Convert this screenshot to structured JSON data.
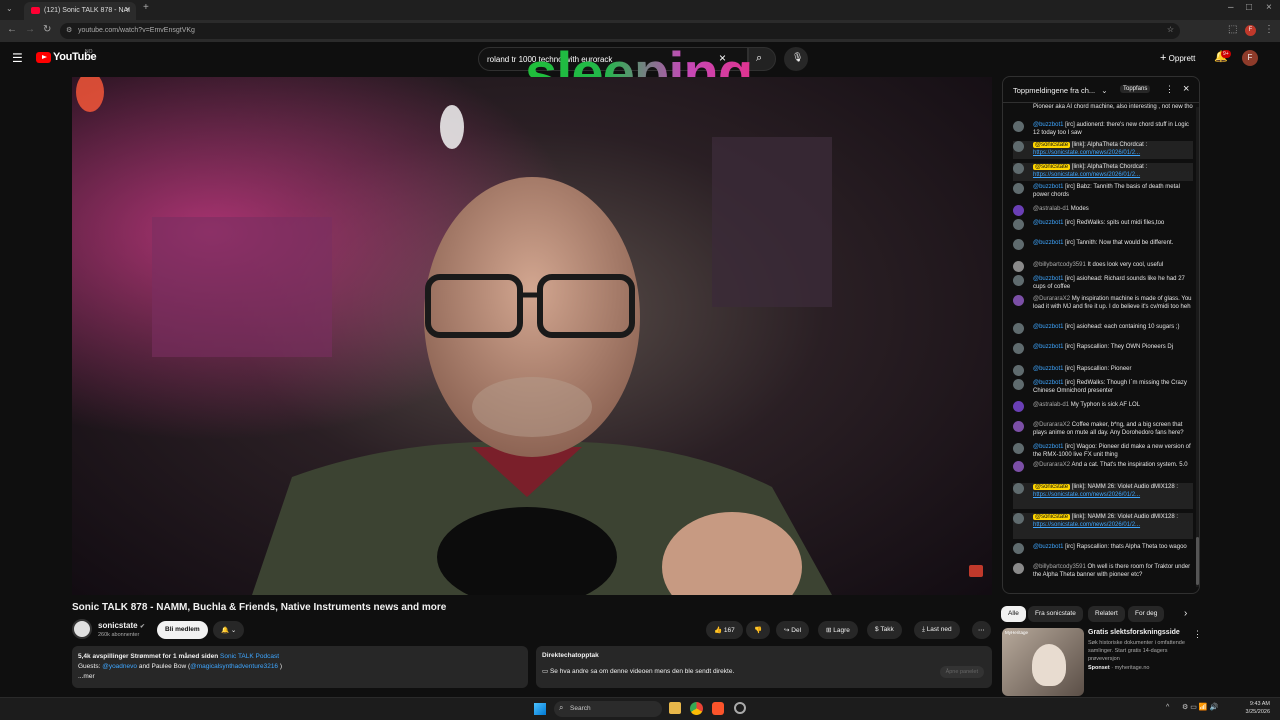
{
  "browser": {
    "tab_title": "(121) Sonic TALK 878 - NAI",
    "url": "youtube.com/watch?v=EmvEnsgtVKg"
  },
  "header": {
    "logo_text": "YouTube",
    "logo_country": "NO",
    "search_value": "roland tr 1000 techno with eurorack",
    "create_label": "Opprett",
    "notif_count": "9+",
    "avatar_letter": "F",
    "overlay_text": "sleeping"
  },
  "video": {
    "title": "Sonic TALK 878 - NAMM, Buchla & Friends, Native Instruments news and more"
  },
  "channel": {
    "name": "sonicstate",
    "subscribers": "260k abonnenter",
    "join_label": "Bli medlem"
  },
  "actions": {
    "likes": "167",
    "share": "Del",
    "save": "Lagre",
    "thanks": "Takk",
    "download": "Last ned"
  },
  "description": {
    "views": "5,4k avspillinger",
    "streamed": "Strømmet for 1 måned siden",
    "podcast": "Sonic TALK Podcast",
    "guests_prefix": "Guests:",
    "guest1": "@yoadnevo",
    "guests_mid": "and Paulee Bow (",
    "guest2": "@magicalsynthadventure3216",
    "guests_suffix": ")",
    "more": "...mer"
  },
  "replay": {
    "title": "Direktechatopptak",
    "text": "Se hva andre sa om denne videoen mens den ble sendt direkte.",
    "button": "Åpne panelet"
  },
  "chat": {
    "header": "Toppmeldingene fra ch...",
    "top_fans": "Toppfans",
    "messages": [
      {
        "author": "",
        "text": "Pioneer aka AI chord machine, also interesting , not new tho"
      },
      {
        "author": "@buzzbot1",
        "text": "[irc] audionerd: there's new chord stuff in Logic 12 today too I saw"
      },
      {
        "author": "@sonicstate",
        "text": "[link]: AlphaTheta Chordcat :",
        "link": "https://sonicstate.com/news/2026/01/2..."
      },
      {
        "author": "@sonicstate",
        "text": "[link]: AlphaTheta Chordcat :",
        "link": "https://sonicstate.com/news/2026/01/2..."
      },
      {
        "author": "@buzzbot1",
        "text": "[irc] Babz: Tannith The basis of death metal power chords"
      },
      {
        "author": "@astralab-d1",
        "text": "Modes"
      },
      {
        "author": "@buzzbot1",
        "text": "[irc] RedWalks: spits out midi files,too"
      },
      {
        "author": "@buzzbot1",
        "text": "[irc] Tannith: Now that would be different."
      },
      {
        "author": "@billybartcody3591",
        "text": "It does look very cool, useful"
      },
      {
        "author": "@buzzbot1",
        "text": "[irc] asiohead: Richard sounds like he had 27 cups of coffee"
      },
      {
        "author": "@DurararaX2",
        "text": "My inspiration machine is made of glass. You load it with MJ and fire it up. I do believe it's cv/midi too heh"
      },
      {
        "author": "@buzzbot1",
        "text": "[irc] asiohead: each containing 10 sugars ;)"
      },
      {
        "author": "@buzzbot1",
        "text": "[irc] Rapscallion: They OWN Pioneers Dj"
      },
      {
        "author": "@buzzbot1",
        "text": "[irc] Rapscallion: Pioneer"
      },
      {
        "author": "@buzzbot1",
        "text": "[irc] RedWalks: Though I`m missing the Crazy Chinese Omnichord presenter"
      },
      {
        "author": "@astralab-d1",
        "text": "My Typhon is sick AF LOL"
      },
      {
        "author": "@DurararaX2",
        "text": "Coffee maker, b*ng, and a big screen that plays anime on mute all day. Any Dorohedoro fans here?"
      },
      {
        "author": "@buzzbot1",
        "text": "[irc] Wagoo: Pioneer did make a new version of the RMX-1000 live FX unit thing"
      },
      {
        "author": "@DurararaX2",
        "text": "And a cat. That's the inspiration system. 5.0"
      },
      {
        "author": "@sonicstate",
        "text": "[link]: NAMM 26: Violet Audio dMIX128 :",
        "link": "https://sonicstate.com/news/2026/01/2..."
      },
      {
        "author": "@sonicstate",
        "text": "[link]: NAMM 26: Violet Audio dMIX128 :",
        "link": "https://sonicstate.com/news/2026/01/2..."
      },
      {
        "author": "@buzzbot1",
        "text": "[irc] Rapscallion: thats Alpha Theta too wagoo"
      },
      {
        "author": "@billybartcody3591",
        "text": "Oh well is there room for Traktor under the Alpha Theta banner with pioneer etc?"
      }
    ]
  },
  "chips": [
    "Alle",
    "Fra sonicstate",
    "Relatert",
    "For deg"
  ],
  "ad": {
    "title": "Gratis slektsforskningsside",
    "desc": "Søk historiske dokumenter i omfattende samlinger. Start gratis 14-dagers prøveversjon",
    "sponsor": "Sponset",
    "domain": "myheritage.no",
    "brand": "MyHeritage"
  },
  "taskbar": {
    "search": "Search",
    "time": "9:43 AM",
    "date": "3/25/2026"
  }
}
